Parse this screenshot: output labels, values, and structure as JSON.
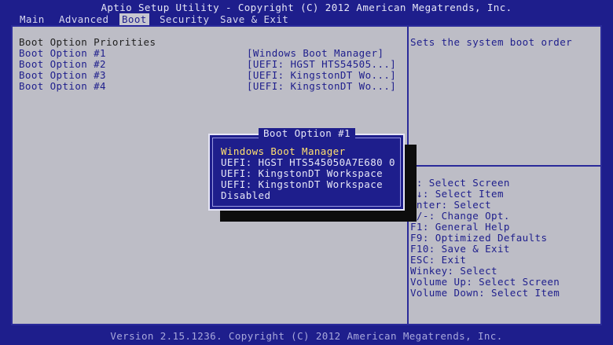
{
  "title": "Aptio Setup Utility - Copyright (C) 2012 American Megatrends, Inc.",
  "menu": [
    "Main",
    "Advanced",
    "Boot",
    "Security",
    "Save & Exit"
  ],
  "active_menu": "Boot",
  "section_title": "Boot Option Priorities",
  "options": [
    {
      "label": "Boot Option #1",
      "value": "[Windows Boot Manager]"
    },
    {
      "label": "Boot Option #2",
      "value": "[UEFI: HGST HTS54505...]"
    },
    {
      "label": "Boot Option #3",
      "value": "[UEFI: KingstonDT Wo...]"
    },
    {
      "label": "Boot Option #4",
      "value": "[UEFI: KingstonDT Wo...]"
    }
  ],
  "help_text": "Sets the system boot order",
  "keys": [
    "←: Select Screen",
    "↑↓: Select Item",
    "Enter: Select",
    "+/-: Change Opt.",
    "F1: General Help",
    "F9: Optimized Defaults",
    "F10: Save & Exit",
    "ESC: Exit",
    "Winkey: Select",
    "Volume Up: Select Screen",
    "Volume Down: Select Item"
  ],
  "popup": {
    "title": "Boot Option #1",
    "items": [
      "Windows Boot Manager",
      "UEFI: HGST HTS545050A7E680 0",
      "UEFI: KingstonDT Workspace",
      "UEFI: KingstonDT Workspace",
      "Disabled"
    ],
    "selected_index": 0
  },
  "footer": "Version 2.15.1236. Copyright (C) 2012 American Megatrends, Inc."
}
